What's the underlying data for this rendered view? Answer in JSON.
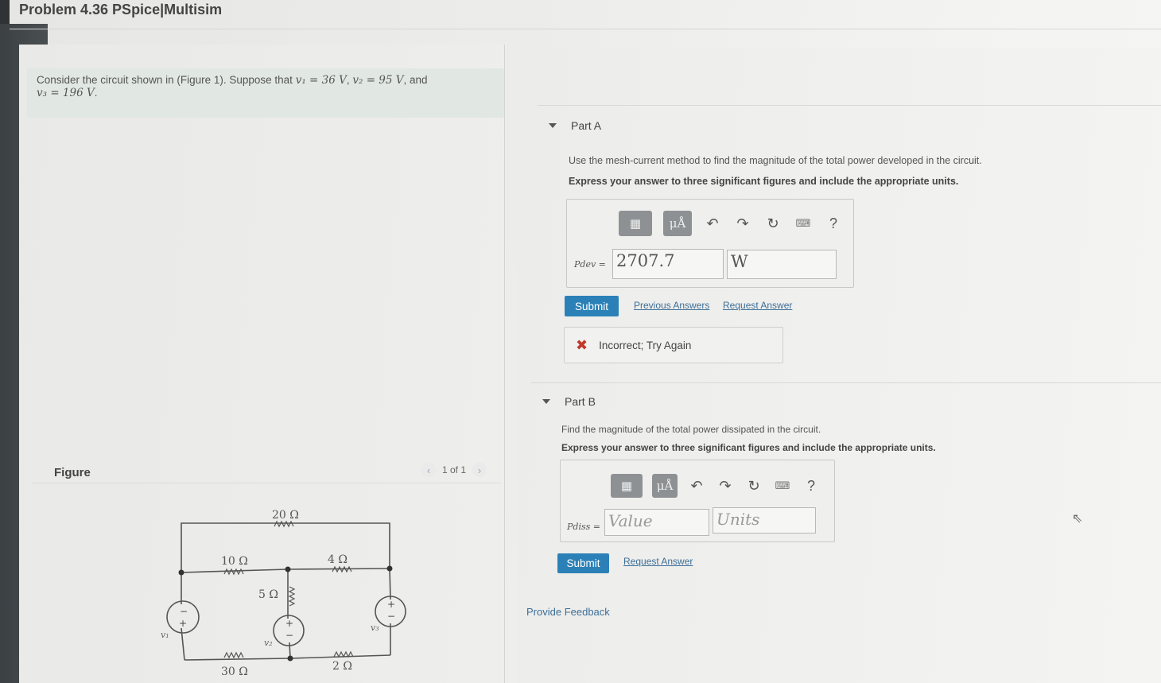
{
  "page": {
    "title": "Problem 4.36 PSpice|Multisim"
  },
  "problem": {
    "text_pre": "Consider the circuit shown in (Figure 1). Suppose that",
    "v1": "v₁ = 36  V",
    "v2": "v₂ = 95  V",
    "and": ", and",
    "v3": "v₃ = 196  V",
    "end": "."
  },
  "figure": {
    "label": "Figure",
    "pager_text": "1 of 1",
    "prev_icon": "chevron-left-icon",
    "next_icon": "chevron-right-icon",
    "circuit": {
      "r20": "20 Ω",
      "r10": "10 Ω",
      "r4": "4 Ω",
      "r5": "5 Ω",
      "r30": "30 Ω",
      "r2": "2 Ω",
      "v1": "v₁",
      "v2": "v₂",
      "v3": "v₃",
      "plus": "+",
      "minus": "−"
    }
  },
  "toolbar": {
    "template_icon": "template-icon",
    "units_label": "μÅ",
    "undo_icon": "↶",
    "redo_icon": "↷",
    "reset_icon": "↻",
    "keyboard_icon": "⌨",
    "help_label": "?"
  },
  "partA": {
    "title": "Part A",
    "instruction": "Use the mesh-current method to find the magnitude of the total power developed in the circuit.",
    "instruction2": "Express your answer to three significant figures and include the appropriate units.",
    "var_label": "Pdev =",
    "value": "2707.7",
    "units": "W",
    "submit": "Submit",
    "prev_answers": "Previous Answers",
    "request_answer": "Request Answer",
    "feedback_icon": "✖",
    "feedback": "Incorrect; Try Again"
  },
  "partB": {
    "title": "Part B",
    "instruction": "Find the magnitude of the total power dissipated in the circuit.",
    "instruction2": "Express your answer to three significant figures and include the appropriate units.",
    "var_label": "Pdiss =",
    "value_placeholder": "Value",
    "units_placeholder": "Units",
    "submit": "Submit",
    "request_answer": "Request Answer"
  },
  "footer": {
    "provide_feedback": "Provide Feedback"
  },
  "colors": {
    "accent": "#2b81b7",
    "error": "#c0392b",
    "link": "#3d6f98"
  }
}
